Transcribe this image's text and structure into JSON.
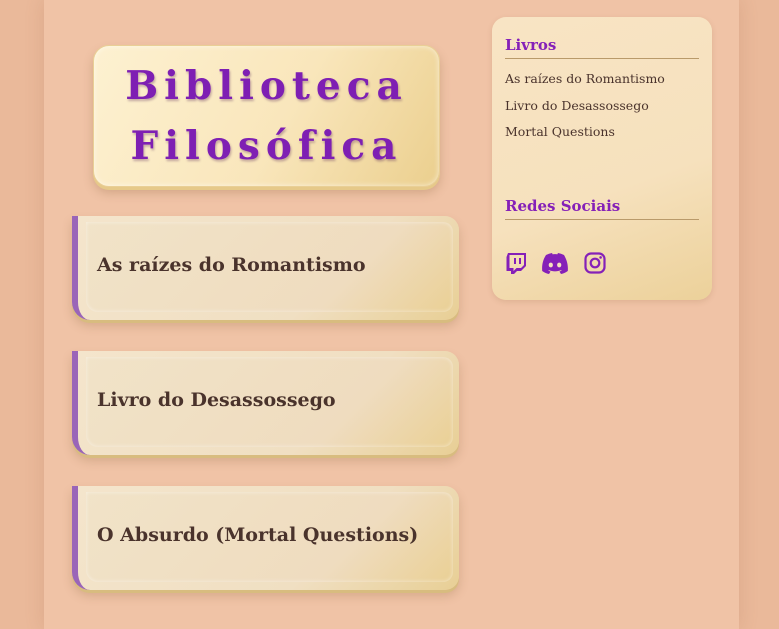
{
  "header": {
    "title_line1": "Biblioteca",
    "title_line2": "Filosófica"
  },
  "main": {
    "books": [
      {
        "title": "As raízes do Romantismo"
      },
      {
        "title": "Livro do Desassossego"
      },
      {
        "title": "O Absurdo (Mortal Questions)"
      }
    ]
  },
  "sidebar": {
    "books_heading": "Livros",
    "books": [
      {
        "label": "As raízes do Romantismo"
      },
      {
        "label": "Livro do Desassossego"
      },
      {
        "label": "Mortal Questions"
      }
    ],
    "social_heading": "Redes Sociais",
    "social": [
      {
        "icon": "twitch-icon"
      },
      {
        "icon": "discord-icon"
      },
      {
        "icon": "instagram-icon"
      }
    ]
  },
  "colors": {
    "accent": "#7e1fb3",
    "heading": "#8520b8",
    "card_border": "#9a65b8",
    "text": "#4a332c",
    "background": "#eab99a"
  }
}
